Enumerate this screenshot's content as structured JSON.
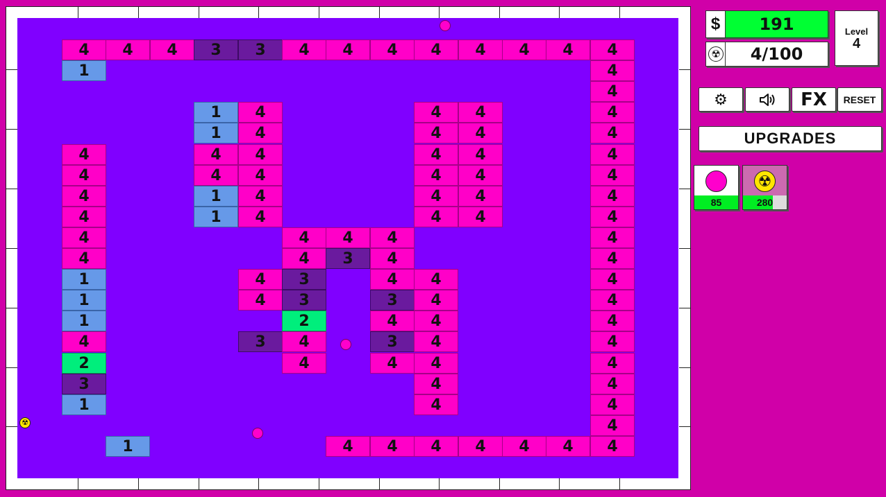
{
  "hud": {
    "money_symbol": "$",
    "money": "191",
    "radiation_icon": "radiation-icon",
    "radiation": "4/100",
    "level_label": "Level",
    "level": "4"
  },
  "buttons": {
    "settings_icon": "gear-icon",
    "sound_icon": "speaker-icon",
    "fx": "FX",
    "reset": "RESET",
    "upgrades": "UPGRADES"
  },
  "ball_shop": [
    {
      "name": "basic-ball",
      "price": "85",
      "affordable": 1.0
    },
    {
      "name": "nuke-ball",
      "price": "280",
      "affordable": 0.68
    }
  ],
  "colors": {
    "background": "#d000a8",
    "field": "#8000ff",
    "brick_1": "#6699e8",
    "brick_2": "#00ee7c",
    "brick_3": "#6a1a9e",
    "brick_4": "#ff00c8",
    "money_bar": "#00ff33"
  },
  "bricks": [
    {
      "col": 1,
      "row": 1,
      "hp": 4
    },
    {
      "col": 2,
      "row": 1,
      "hp": 4
    },
    {
      "col": 3,
      "row": 1,
      "hp": 4
    },
    {
      "col": 4,
      "row": 1,
      "hp": 3
    },
    {
      "col": 5,
      "row": 1,
      "hp": 3
    },
    {
      "col": 6,
      "row": 1,
      "hp": 4
    },
    {
      "col": 7,
      "row": 1,
      "hp": 4
    },
    {
      "col": 8,
      "row": 1,
      "hp": 4
    },
    {
      "col": 9,
      "row": 1,
      "hp": 4
    },
    {
      "col": 10,
      "row": 1,
      "hp": 4
    },
    {
      "col": 11,
      "row": 1,
      "hp": 4
    },
    {
      "col": 12,
      "row": 1,
      "hp": 4
    },
    {
      "col": 13,
      "row": 1,
      "hp": 4
    },
    {
      "col": 1,
      "row": 2,
      "hp": 1
    },
    {
      "col": 13,
      "row": 2,
      "hp": 4
    },
    {
      "col": 13,
      "row": 3,
      "hp": 4
    },
    {
      "col": 4,
      "row": 4,
      "hp": 1
    },
    {
      "col": 5,
      "row": 4,
      "hp": 4
    },
    {
      "col": 9,
      "row": 4,
      "hp": 4
    },
    {
      "col": 10,
      "row": 4,
      "hp": 4
    },
    {
      "col": 13,
      "row": 4,
      "hp": 4
    },
    {
      "col": 4,
      "row": 5,
      "hp": 1
    },
    {
      "col": 5,
      "row": 5,
      "hp": 4
    },
    {
      "col": 9,
      "row": 5,
      "hp": 4
    },
    {
      "col": 10,
      "row": 5,
      "hp": 4
    },
    {
      "col": 13,
      "row": 5,
      "hp": 4
    },
    {
      "col": 1,
      "row": 6,
      "hp": 4
    },
    {
      "col": 4,
      "row": 6,
      "hp": 4
    },
    {
      "col": 5,
      "row": 6,
      "hp": 4
    },
    {
      "col": 9,
      "row": 6,
      "hp": 4
    },
    {
      "col": 10,
      "row": 6,
      "hp": 4
    },
    {
      "col": 13,
      "row": 6,
      "hp": 4
    },
    {
      "col": 1,
      "row": 7,
      "hp": 4
    },
    {
      "col": 4,
      "row": 7,
      "hp": 4
    },
    {
      "col": 5,
      "row": 7,
      "hp": 4
    },
    {
      "col": 9,
      "row": 7,
      "hp": 4
    },
    {
      "col": 10,
      "row": 7,
      "hp": 4
    },
    {
      "col": 13,
      "row": 7,
      "hp": 4
    },
    {
      "col": 1,
      "row": 8,
      "hp": 4
    },
    {
      "col": 4,
      "row": 8,
      "hp": 1
    },
    {
      "col": 5,
      "row": 8,
      "hp": 4
    },
    {
      "col": 9,
      "row": 8,
      "hp": 4
    },
    {
      "col": 10,
      "row": 8,
      "hp": 4
    },
    {
      "col": 13,
      "row": 8,
      "hp": 4
    },
    {
      "col": 1,
      "row": 9,
      "hp": 4
    },
    {
      "col": 4,
      "row": 9,
      "hp": 1
    },
    {
      "col": 5,
      "row": 9,
      "hp": 4
    },
    {
      "col": 9,
      "row": 9,
      "hp": 4
    },
    {
      "col": 10,
      "row": 9,
      "hp": 4
    },
    {
      "col": 13,
      "row": 9,
      "hp": 4
    },
    {
      "col": 1,
      "row": 10,
      "hp": 4
    },
    {
      "col": 6,
      "row": 10,
      "hp": 4
    },
    {
      "col": 7,
      "row": 10,
      "hp": 4
    },
    {
      "col": 8,
      "row": 10,
      "hp": 4
    },
    {
      "col": 13,
      "row": 10,
      "hp": 4
    },
    {
      "col": 1,
      "row": 11,
      "hp": 4
    },
    {
      "col": 6,
      "row": 11,
      "hp": 4
    },
    {
      "col": 7,
      "row": 11,
      "hp": 3
    },
    {
      "col": 8,
      "row": 11,
      "hp": 4
    },
    {
      "col": 13,
      "row": 11,
      "hp": 4
    },
    {
      "col": 1,
      "row": 12,
      "hp": 1
    },
    {
      "col": 5,
      "row": 12,
      "hp": 4
    },
    {
      "col": 6,
      "row": 12,
      "hp": 3
    },
    {
      "col": 8,
      "row": 12,
      "hp": 4
    },
    {
      "col": 9,
      "row": 12,
      "hp": 4
    },
    {
      "col": 13,
      "row": 12,
      "hp": 4
    },
    {
      "col": 1,
      "row": 13,
      "hp": 1
    },
    {
      "col": 5,
      "row": 13,
      "hp": 4
    },
    {
      "col": 6,
      "row": 13,
      "hp": 3
    },
    {
      "col": 8,
      "row": 13,
      "hp": 3
    },
    {
      "col": 9,
      "row": 13,
      "hp": 4
    },
    {
      "col": 13,
      "row": 13,
      "hp": 4
    },
    {
      "col": 1,
      "row": 14,
      "hp": 1
    },
    {
      "col": 6,
      "row": 14,
      "hp": 2
    },
    {
      "col": 8,
      "row": 14,
      "hp": 4
    },
    {
      "col": 9,
      "row": 14,
      "hp": 4
    },
    {
      "col": 13,
      "row": 14,
      "hp": 4
    },
    {
      "col": 1,
      "row": 15,
      "hp": 4
    },
    {
      "col": 5,
      "row": 15,
      "hp": 3
    },
    {
      "col": 6,
      "row": 15,
      "hp": 4
    },
    {
      "col": 8,
      "row": 15,
      "hp": 3
    },
    {
      "col": 9,
      "row": 15,
      "hp": 4
    },
    {
      "col": 13,
      "row": 15,
      "hp": 4
    },
    {
      "col": 1,
      "row": 16,
      "hp": 2
    },
    {
      "col": 6,
      "row": 16,
      "hp": 4
    },
    {
      "col": 8,
      "row": 16,
      "hp": 4
    },
    {
      "col": 9,
      "row": 16,
      "hp": 4
    },
    {
      "col": 13,
      "row": 16,
      "hp": 4
    },
    {
      "col": 1,
      "row": 17,
      "hp": 3
    },
    {
      "col": 9,
      "row": 17,
      "hp": 4
    },
    {
      "col": 13,
      "row": 17,
      "hp": 4
    },
    {
      "col": 1,
      "row": 18,
      "hp": 1
    },
    {
      "col": 9,
      "row": 18,
      "hp": 4
    },
    {
      "col": 13,
      "row": 18,
      "hp": 4
    },
    {
      "col": 13,
      "row": 19,
      "hp": 4
    },
    {
      "col": 2,
      "row": 20,
      "hp": 1
    },
    {
      "col": 7,
      "row": 20,
      "hp": 4
    },
    {
      "col": 8,
      "row": 20,
      "hp": 4
    },
    {
      "col": 9,
      "row": 20,
      "hp": 4
    },
    {
      "col": 10,
      "row": 20,
      "hp": 4
    },
    {
      "col": 11,
      "row": 20,
      "hp": 4
    },
    {
      "col": 12,
      "row": 20,
      "hp": 4
    },
    {
      "col": 13,
      "row": 20,
      "hp": 4
    }
  ],
  "balls": [
    {
      "type": "basic"
    },
    {
      "type": "basic"
    },
    {
      "type": "basic"
    },
    {
      "type": "nuke"
    }
  ]
}
